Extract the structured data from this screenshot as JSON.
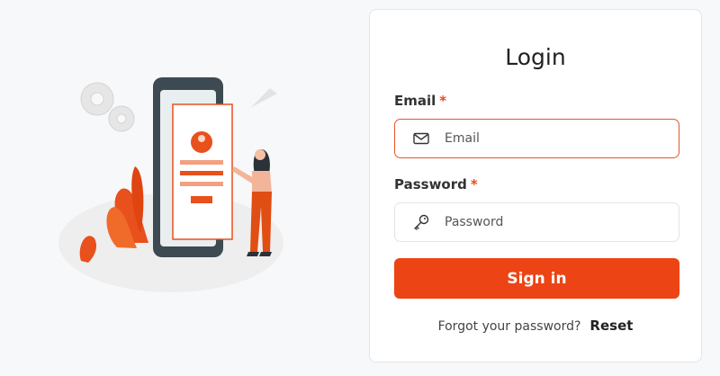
{
  "login": {
    "title": "Login",
    "email_label": "Email",
    "email_required": "*",
    "email_placeholder": "Email",
    "password_label": "Password",
    "password_required": "*",
    "password_placeholder": "Password",
    "signin_label": "Sign in",
    "forgot_text": "Forgot your password?",
    "reset_label": "Reset"
  },
  "icons": {
    "email": "envelope-icon",
    "password": "key-icon"
  },
  "colors": {
    "accent": "#ec4414",
    "focus_border": "#e8552b",
    "required": "#e84a1a",
    "background": "#f7f8fa"
  }
}
